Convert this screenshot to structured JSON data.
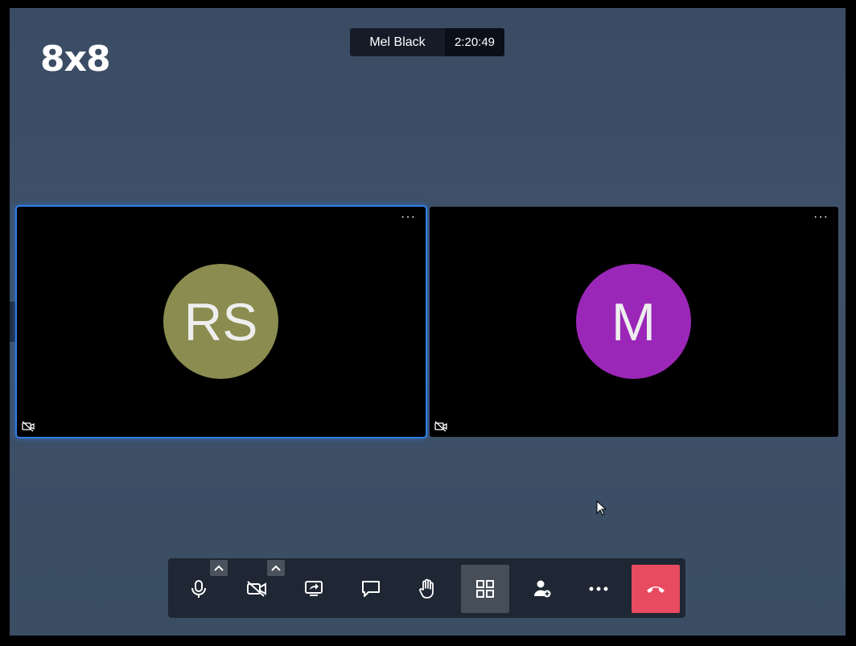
{
  "app": {
    "logo": "8x8"
  },
  "meeting": {
    "host_name": "Mel Black",
    "elapsed": "2:20:49"
  },
  "tiles": [
    {
      "initials": "RS",
      "avatar_color": "#8a8c50",
      "active": true,
      "more": "···"
    },
    {
      "initials": "M",
      "avatar_color": "#9b27b8",
      "active": false,
      "more": "···"
    }
  ],
  "toolbar": {
    "buttons": [
      {
        "name": "microphone",
        "icon": "mic-icon",
        "has_options": true
      },
      {
        "name": "camera",
        "icon": "video-off-icon",
        "has_options": true
      },
      {
        "name": "share-screen",
        "icon": "screen-share-icon"
      },
      {
        "name": "chat",
        "icon": "chat-icon"
      },
      {
        "name": "raise-hand",
        "icon": "hand-icon"
      },
      {
        "name": "tile-view",
        "icon": "grid-icon",
        "selected": true
      },
      {
        "name": "invite",
        "icon": "add-person-icon"
      },
      {
        "name": "more-actions",
        "icon": "more-icon"
      },
      {
        "name": "leave-call",
        "icon": "hangup-icon",
        "color": "#e84a5f"
      }
    ]
  }
}
